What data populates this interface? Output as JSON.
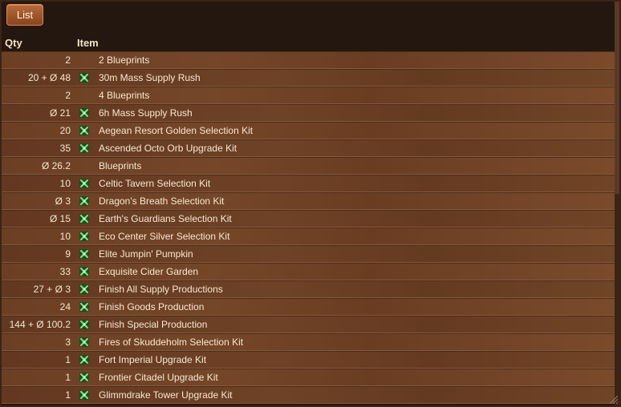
{
  "toolbar": {
    "list_label": "List"
  },
  "columns": {
    "qty": "Qty",
    "item": "Item"
  },
  "icon_name": "green-puzzle-icon",
  "rows": [
    {
      "qty": "2",
      "name": "2 Blueprints",
      "icon": false
    },
    {
      "qty": "20 + Ø 48",
      "name": "30m Mass Supply Rush",
      "icon": true
    },
    {
      "qty": "2",
      "name": "4 Blueprints",
      "icon": false
    },
    {
      "qty": "Ø 21",
      "name": "6h Mass Supply Rush",
      "icon": true
    },
    {
      "qty": "20",
      "name": "Aegean Resort Golden Selection Kit",
      "icon": true
    },
    {
      "qty": "35",
      "name": "Ascended Octo Orb Upgrade Kit",
      "icon": true
    },
    {
      "qty": "Ø 26.2",
      "name": "Blueprints",
      "icon": false
    },
    {
      "qty": "10",
      "name": "Celtic Tavern Selection Kit",
      "icon": true
    },
    {
      "qty": "Ø 3",
      "name": "Dragon's Breath Selection Kit",
      "icon": true
    },
    {
      "qty": "Ø 15",
      "name": "Earth's Guardians Selection Kit",
      "icon": true
    },
    {
      "qty": "10",
      "name": "Eco Center Silver Selection Kit",
      "icon": true
    },
    {
      "qty": "9",
      "name": "Elite Jumpin' Pumpkin",
      "icon": true
    },
    {
      "qty": "33",
      "name": "Exquisite Cider Garden",
      "icon": true
    },
    {
      "qty": "27 + Ø 3",
      "name": "Finish All Supply Productions",
      "icon": true
    },
    {
      "qty": "24",
      "name": "Finish Goods Production",
      "icon": true
    },
    {
      "qty": "144 + Ø 100.2",
      "name": "Finish Special Production",
      "icon": true
    },
    {
      "qty": "3",
      "name": "Fires of Skuddeholm Selection Kit",
      "icon": true
    },
    {
      "qty": "1",
      "name": "Fort Imperial Upgrade Kit",
      "icon": true
    },
    {
      "qty": "1",
      "name": "Frontier Citadel Upgrade Kit",
      "icon": true
    },
    {
      "qty": "1",
      "name": "Glimmdrake Tower Upgrade Kit",
      "icon": true
    }
  ]
}
